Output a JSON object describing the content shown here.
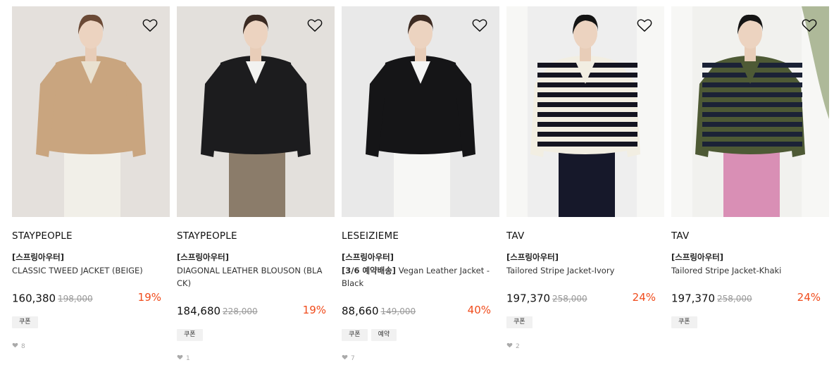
{
  "products": [
    {
      "brand": "STAYPEOPLE",
      "tag": "[스프링아우터]",
      "name_bold": "",
      "name": "CLASSIC TWEED JACKET (BEIGE)",
      "price": "160,380",
      "original_price": "198,000",
      "discount": "19%",
      "badges": [
        "쿠폰"
      ],
      "likes": "8",
      "photo": {
        "bg": "#e4e0dc",
        "garment": "#c9a57f",
        "accent": "#e9e1d0",
        "bottom": "#f1efe8",
        "hair": "#6b4a36",
        "pattern": "none"
      }
    },
    {
      "brand": "STAYPEOPLE",
      "tag": "[스프링아우터]",
      "name_bold": "",
      "name": "DIAGONAL LEATHER BLOUSON (BLACK)",
      "price": "184,680",
      "original_price": "228,000",
      "discount": "19%",
      "badges": [
        "쿠폰"
      ],
      "likes": "1",
      "photo": {
        "bg": "#e3e0dc",
        "garment": "#1c1c1e",
        "accent": "#f2f2f0",
        "bottom": "#8b7c6a",
        "hair": "#3a2a22",
        "pattern": "none"
      }
    },
    {
      "brand": "LESEIZIEME",
      "tag": "[스프링아우터]",
      "name_bold": "[3/6 예약배송]",
      "name": " Vegan Leather Jacket - Black",
      "price": "88,660",
      "original_price": "149,000",
      "discount": "40%",
      "badges": [
        "쿠폰",
        "예약"
      ],
      "likes": "7",
      "photo": {
        "bg": "#e9e9e9",
        "garment": "#151517",
        "accent": "#f4f4f4",
        "bottom": "#f7f7f5",
        "hair": "#3d2b22",
        "pattern": "none"
      }
    },
    {
      "brand": "TAV",
      "tag": "[스프링아우터]",
      "name_bold": "",
      "name": "Tailored Stripe Jacket-Ivory",
      "price": "197,370",
      "original_price": "258,000",
      "discount": "24%",
      "badges": [
        "쿠폰"
      ],
      "likes": "2",
      "photo": {
        "bg": "#eeeeee",
        "garment": "#f2eee2",
        "accent": "#141420",
        "bottom": "#16182a",
        "hair": "#141414",
        "pattern": "stripe-navy"
      }
    },
    {
      "brand": "TAV",
      "tag": "[스프링아우터]",
      "name_bold": "",
      "name": "Tailored Stripe Jacket-Khaki",
      "price": "197,370",
      "original_price": "258,000",
      "discount": "24%",
      "badges": [
        "쿠폰"
      ],
      "likes": "",
      "photo": {
        "bg": "#f1f1ee",
        "garment": "#4e5a35",
        "accent": "#1b2236",
        "bottom": "#d98fb5",
        "hair": "#151515",
        "pattern": "stripe-khaki"
      }
    }
  ],
  "colors": {
    "discount": "#f04b1b",
    "badge_bg": "#f1f1f1",
    "strike": "#999999"
  },
  "icons": {
    "wish": "heart-outline-icon",
    "like": "heart-filled-icon"
  }
}
